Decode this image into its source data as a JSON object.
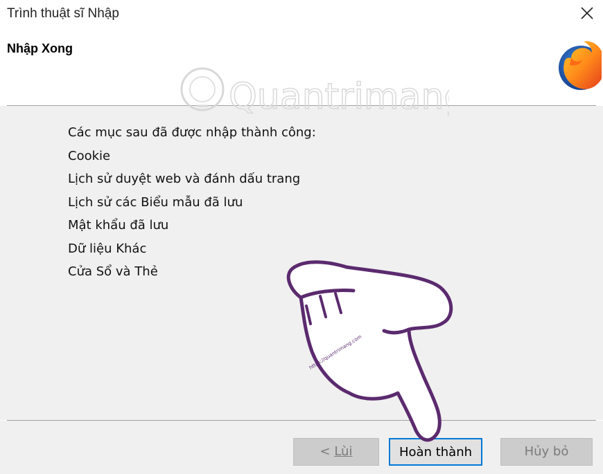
{
  "window": {
    "title": "Trình thuật sĩ Nhập"
  },
  "header": {
    "heading": "Nhập Xong"
  },
  "content": {
    "items": [
      "Các mục sau đã được nhập thành công:",
      "Cookie",
      "Lịch sử duyệt web và đánh dấu trang",
      "Lịch sử các Biểu mẫu đã lưu",
      "Mật khẩu đã lưu",
      "Dữ liệu Khác",
      "Cửa Sổ và Thẻ"
    ]
  },
  "buttons": {
    "back_prefix": "< ",
    "back_label": "Lùi",
    "finish_label": "Hoàn thành",
    "cancel_label": "Hủy bỏ"
  },
  "overlay": {
    "watermark_text": "Quantrimang",
    "hand_url_text": "https://quantrimang.com"
  },
  "colors": {
    "focus_border": "#0078d7",
    "hand_stroke": "#5b2a6e",
    "disabled_text": "#7a7a7a"
  },
  "icons": {
    "close": "close-icon",
    "logo": "firefox-logo-icon",
    "pointer": "pointing-hand-icon"
  }
}
